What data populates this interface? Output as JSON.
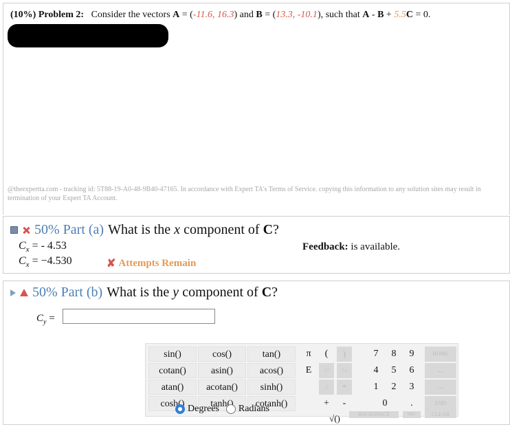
{
  "problem": {
    "header": "(10%) Problem 2:",
    "text_pre": "Consider the vectors ",
    "vecA_name": "A",
    "vecA_vals": "-11.6, 16.3",
    "vecB_name": "B",
    "vecB_vals": "13.3, -10.1",
    "coef": "5.5",
    "text_suffix": "C = 0."
  },
  "watermark": "@theexpertta.com - tracking id: 5T88-19-A0-48-9B40-47165. In accordance with Expert TA's Terms of Service. copying this information to any solution sites may result in termination of your Expert TA Account.",
  "part_a": {
    "title": "50% Part (a)",
    "question_pre": "What is the ",
    "question_var": "x",
    "question_mid": " component of ",
    "question_vec": "C",
    "question_end": "?",
    "answer1_label": "C",
    "answer1_sub": "x",
    "answer1_value": " = - 4.53",
    "answer2_label": "C",
    "answer2_sub": "x",
    "answer2_value": " = −4.530",
    "feedback_label": "Feedback:",
    "feedback_text": " is available.",
    "attempts_text": "Attempts Remain",
    "colors": {
      "title": "#4d7fb3",
      "attempts": "#e39a55",
      "error": "#d9534f"
    }
  },
  "part_b": {
    "title": "50% Part (b)",
    "question_pre": "What is the ",
    "question_var": "y",
    "question_mid": " component of ",
    "question_vec": "C",
    "question_end": "?",
    "input_label": "C",
    "input_sub": "y",
    "input_eq": " =",
    "input_value": ""
  },
  "keypad": {
    "functions": [
      "sin()",
      "cos()",
      "tan()",
      "cotan()",
      "asin()",
      "acos()",
      "atan()",
      "acotan()",
      "sinh()",
      "cosh()",
      "tanh()",
      "cotanh()"
    ],
    "constants": [
      "π",
      "E"
    ],
    "parens": [
      "(",
      ")"
    ],
    "arrows": [
      "↑^",
      "^↓"
    ],
    "ops": [
      "/",
      "*",
      "+",
      "-"
    ],
    "sqrt": "√()",
    "digits": [
      "7",
      "8",
      "9",
      "4",
      "5",
      "6",
      "1",
      "2",
      "3",
      "0",
      "."
    ],
    "home": "HOME",
    "back_arrow": "←",
    "fwd_arrow": "→",
    "end": "END",
    "backspace": "BACKSPACE",
    "del": "DEL",
    "clear": "CLEAR",
    "degrees": "Degrees",
    "radians": "Radians",
    "angle_mode": "Degrees"
  }
}
